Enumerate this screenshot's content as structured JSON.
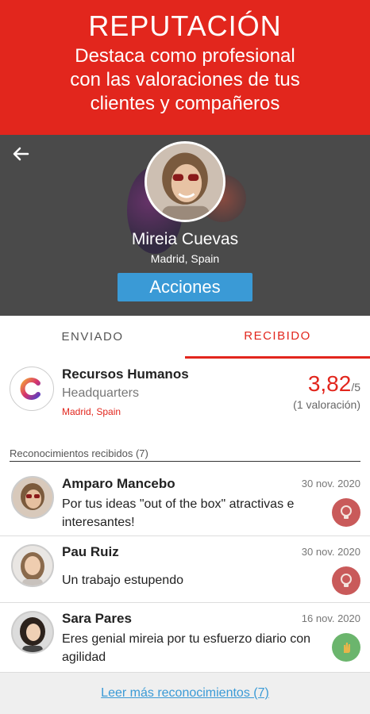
{
  "promo": {
    "title": "REPUTACIÓN",
    "subtitle_lines": [
      "Destaca como profesional",
      "con las valoraciones de tus",
      "clientes y compañeros"
    ]
  },
  "profile": {
    "back_icon": "arrow-left-icon",
    "name": "Mireia Cuevas",
    "location": "Madrid, Spain",
    "actions_label": "Acciones"
  },
  "tabs": {
    "sent": "ENVIADO",
    "received": "RECIBIDO",
    "active": "received"
  },
  "company": {
    "name": "Recursos Humanos",
    "subtitle": "Headquarters",
    "location": "Madrid, Spain",
    "rating": "3,82",
    "rating_max": "/5",
    "rating_count": "(1 valoración)"
  },
  "section_label": "Reconocimientos recibidos (7)",
  "recognitions": [
    {
      "name": "Amparo Mancebo",
      "date": "30 nov. 2020",
      "message": "Por tus ideas \"out of the box\" atractivas e interesantes!",
      "badge_icon": "lightbulb-icon",
      "badge_color": "#c95a5a"
    },
    {
      "name": "Pau Ruiz",
      "date": "30 nov. 2020",
      "message": "Un trabajo estupendo",
      "badge_icon": "lightbulb-icon",
      "badge_color": "#c95a5a"
    },
    {
      "name": "Sara Pares",
      "date": "16 nov. 2020",
      "message": "Eres genial mireia por tu esfuerzo diario con agilidad",
      "badge_icon": "hand-icon",
      "badge_color": "#6bb56d"
    }
  ],
  "footer": {
    "more_label": "Leer más reconocimientos (7)"
  },
  "colors": {
    "brand_red": "#e2261d",
    "action_blue": "#3a9ad6",
    "header_gray": "#4a4a4a"
  }
}
